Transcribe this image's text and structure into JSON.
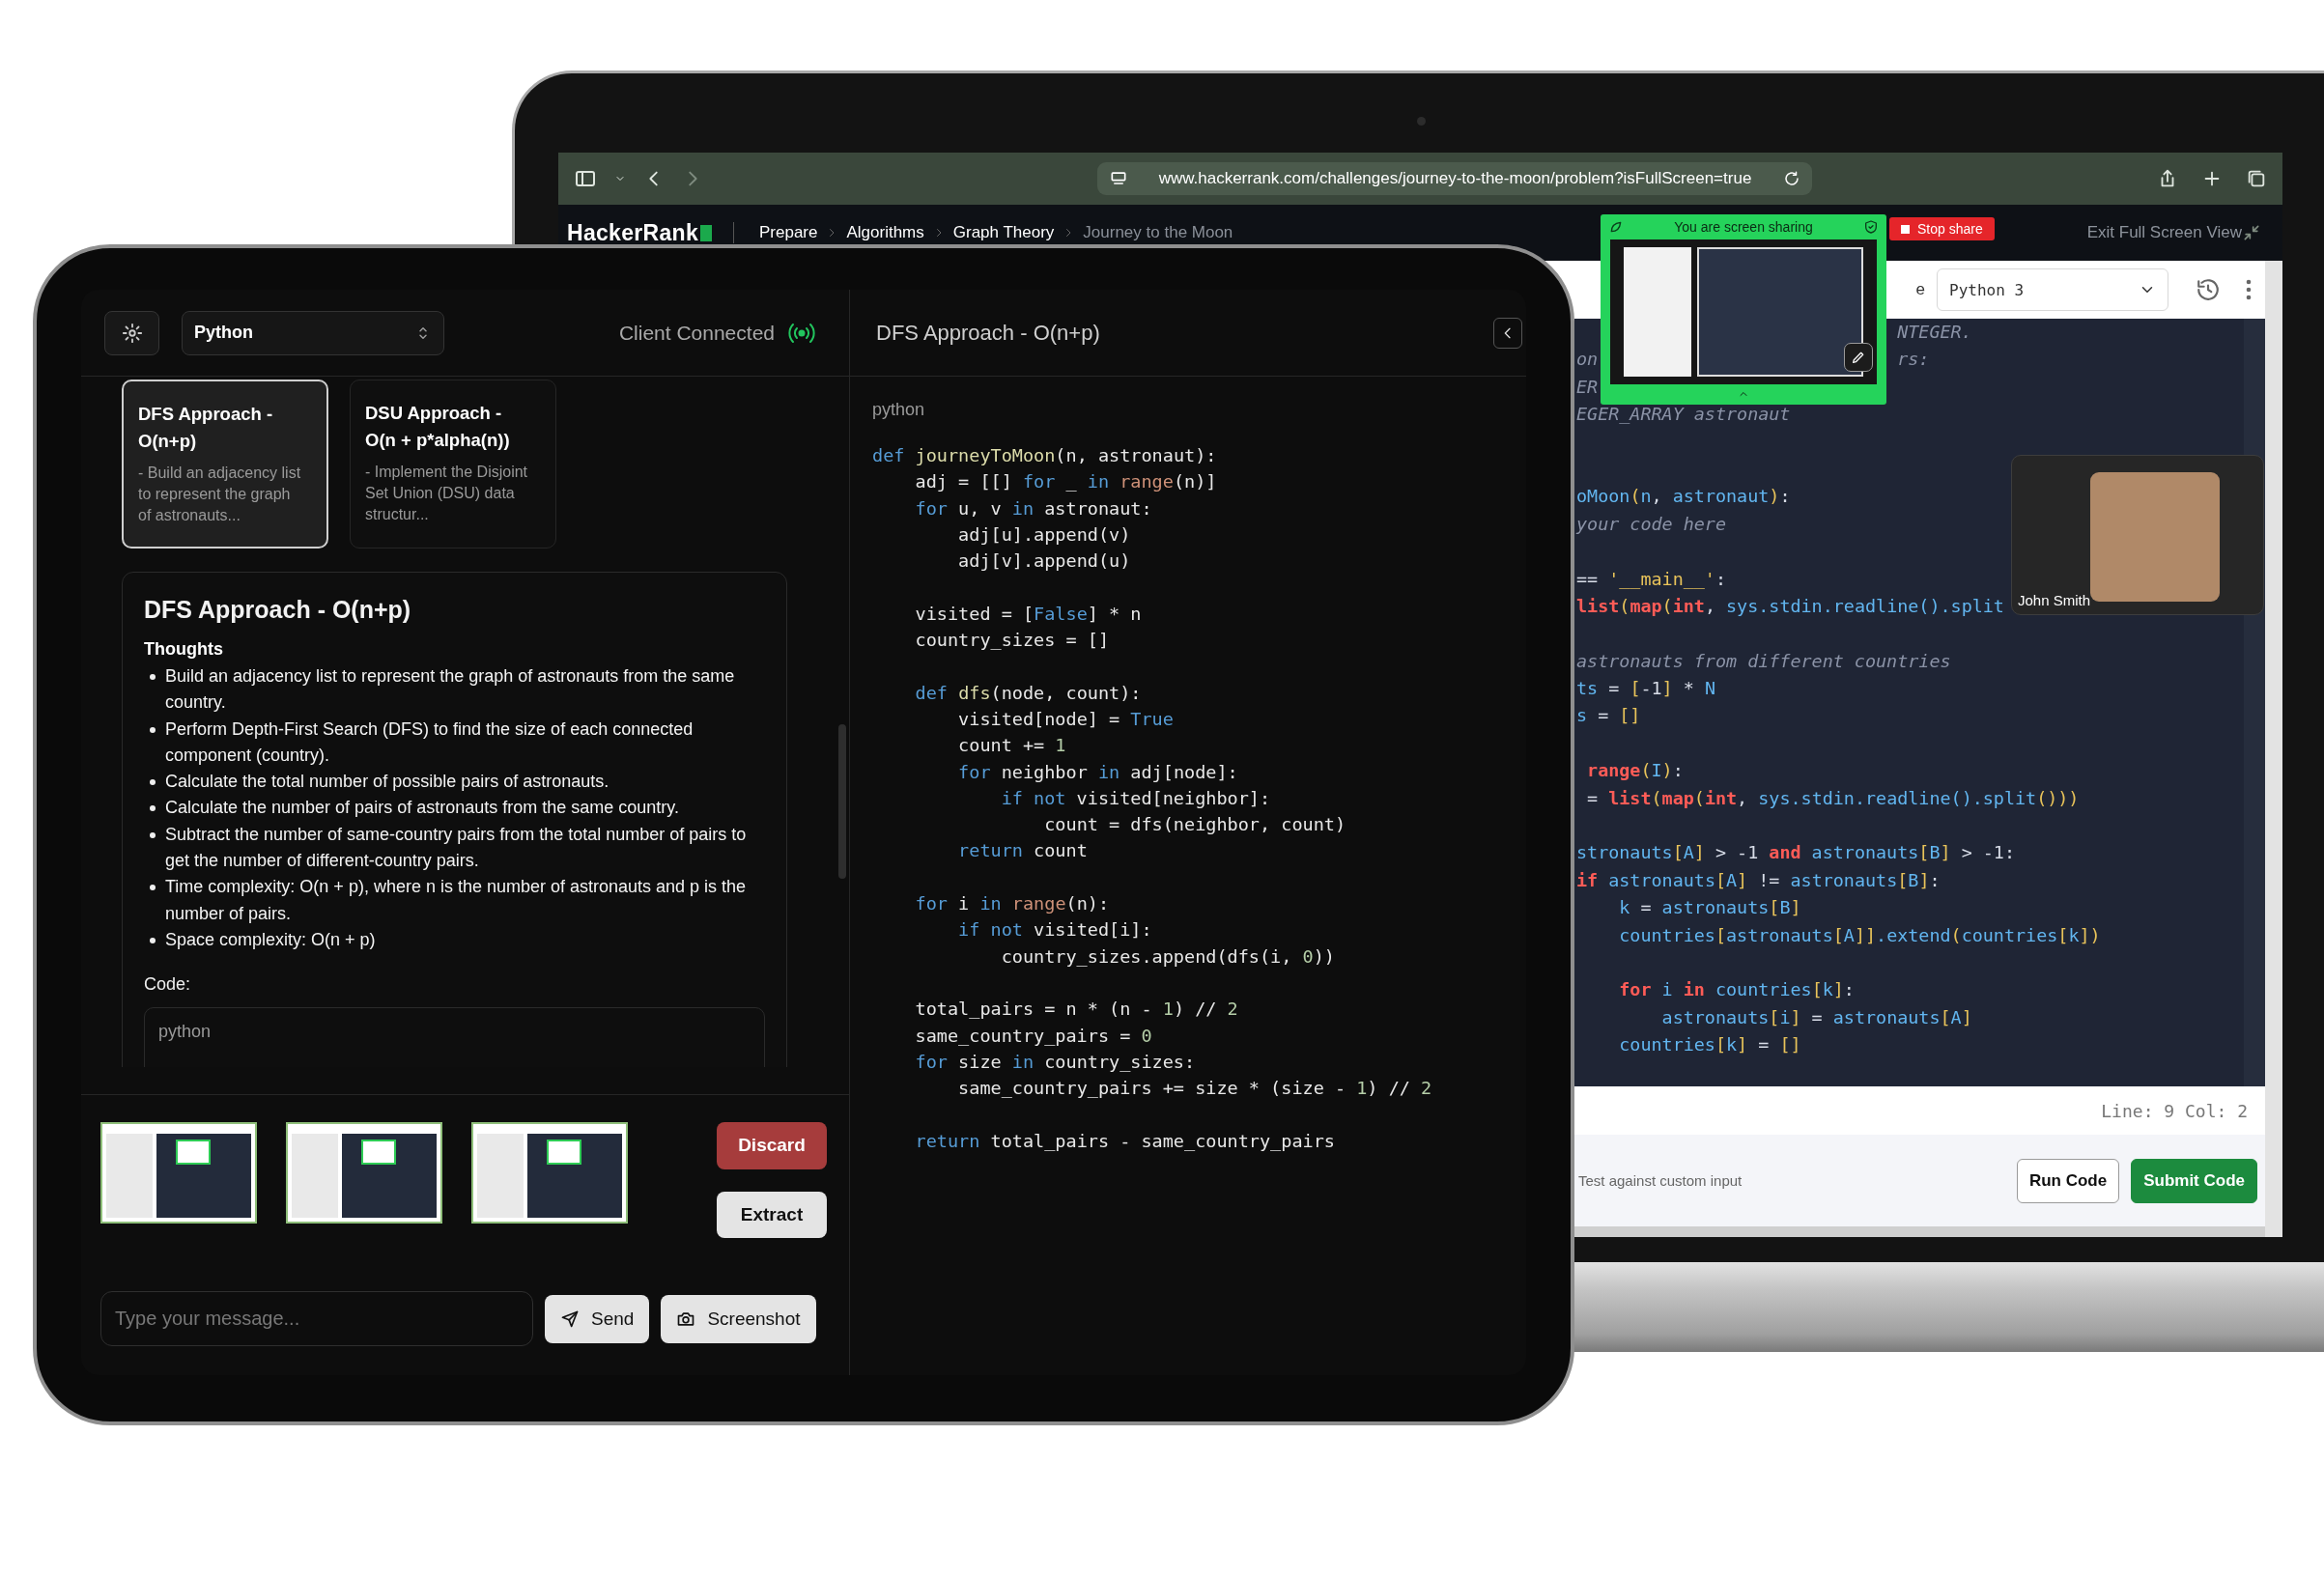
{
  "laptop": {
    "browser": {
      "url": "www.hackerrank.com/challenges/journey-to-the-moon/problem?isFullScreen=true"
    },
    "site_nav": {
      "logo": "HackerRank",
      "breadcrumbs": [
        {
          "label": "Prepare",
          "selected": false
        },
        {
          "label": "Algorithms",
          "selected": false
        },
        {
          "label": "Graph Theory",
          "selected": false
        },
        {
          "label": "Journey to the Moon",
          "selected": true
        }
      ],
      "exit_label": "Exit Full Screen View"
    },
    "screen_share": {
      "message": "You are screen sharing",
      "stop_label": "Stop share"
    },
    "editor": {
      "language_label": "e",
      "language": "Python 3",
      "code": [
        {
          "text": "                              NTEGER.\n",
          "kind": "comment"
        },
        {
          "text": "on                            rs:\n",
          "kind": "comment"
        },
        {
          "text": "ER\n",
          "kind": "comment"
        },
        {
          "text": "EGER_ARRAY astronaut\n\n\n",
          "kind": "comment"
        },
        {
          "text": "oMoon",
          "kind": "identifier"
        },
        {
          "text": "(",
          "kind": "bracket"
        },
        {
          "text": "n",
          "kind": "identifier"
        },
        {
          "text": ", ",
          "kind": "plain"
        },
        {
          "text": "astronaut",
          "kind": "identifier"
        },
        {
          "text": ")",
          "kind": "bracket"
        },
        {
          "text": ":\n",
          "kind": "plain"
        },
        {
          "text": "your code here\n\n",
          "kind": "comment"
        },
        {
          "text": "== ",
          "kind": "plain"
        },
        {
          "text": "'__main__'",
          "kind": "string"
        },
        {
          "text": ":\n",
          "kind": "plain"
        },
        {
          "text": "list",
          "kind": "keyword"
        },
        {
          "text": "(",
          "kind": "bracket"
        },
        {
          "text": "map",
          "kind": "keyword"
        },
        {
          "text": "(",
          "kind": "bracket"
        },
        {
          "text": "int",
          "kind": "keyword"
        },
        {
          "text": ", ",
          "kind": "plain"
        },
        {
          "text": "sys.stdin.readline().split\n\n",
          "kind": "identifier"
        },
        {
          "text": "astronauts from different countries\n",
          "kind": "comment"
        },
        {
          "text": "ts",
          "kind": "identifier"
        },
        {
          "text": " = ",
          "kind": "plain"
        },
        {
          "text": "[",
          "kind": "bracket"
        },
        {
          "text": "-1",
          "kind": "plain"
        },
        {
          "text": "]",
          "kind": "bracket"
        },
        {
          "text": " * ",
          "kind": "plain"
        },
        {
          "text": "N\n",
          "kind": "identifier"
        },
        {
          "text": "s",
          "kind": "identifier"
        },
        {
          "text": " = ",
          "kind": "plain"
        },
        {
          "text": "[]\n\n",
          "kind": "bracket"
        },
        {
          "text": " range",
          "kind": "keyword"
        },
        {
          "text": "(",
          "kind": "bracket"
        },
        {
          "text": "I",
          "kind": "identifier"
        },
        {
          "text": ")",
          "kind": "bracket"
        },
        {
          "text": ":\n = ",
          "kind": "plain"
        },
        {
          "text": "list",
          "kind": "keyword"
        },
        {
          "text": "(",
          "kind": "bracket"
        },
        {
          "text": "map",
          "kind": "keyword"
        },
        {
          "text": "(",
          "kind": "bracket"
        },
        {
          "text": "int",
          "kind": "keyword"
        },
        {
          "text": ", ",
          "kind": "plain"
        },
        {
          "text": "sys.stdin.readline().split",
          "kind": "identifier"
        },
        {
          "text": "()))\n\n",
          "kind": "bracket"
        },
        {
          "text": "stronauts",
          "kind": "identifier"
        },
        {
          "text": "[",
          "kind": "bracket"
        },
        {
          "text": "A",
          "kind": "identifier"
        },
        {
          "text": "]",
          "kind": "bracket"
        },
        {
          "text": " > -1 ",
          "kind": "plain"
        },
        {
          "text": "and",
          "kind": "keyword"
        },
        {
          "text": " astronauts",
          "kind": "identifier"
        },
        {
          "text": "[",
          "kind": "bracket"
        },
        {
          "text": "B",
          "kind": "identifier"
        },
        {
          "text": "]",
          "kind": "bracket"
        },
        {
          "text": " > -1:\n",
          "kind": "plain"
        },
        {
          "text": "if",
          "kind": "keyword"
        },
        {
          "text": " astronauts",
          "kind": "identifier"
        },
        {
          "text": "[",
          "kind": "bracket"
        },
        {
          "text": "A",
          "kind": "identifier"
        },
        {
          "text": "]",
          "kind": "bracket"
        },
        {
          "text": " != ",
          "kind": "plain"
        },
        {
          "text": "astronauts",
          "kind": "identifier"
        },
        {
          "text": "[",
          "kind": "bracket"
        },
        {
          "text": "B",
          "kind": "identifier"
        },
        {
          "text": "]",
          "kind": "bracket"
        },
        {
          "text": ":\n",
          "kind": "plain"
        },
        {
          "text": "    k",
          "kind": "identifier"
        },
        {
          "text": " = ",
          "kind": "plain"
        },
        {
          "text": "astronauts",
          "kind": "identifier"
        },
        {
          "text": "[",
          "kind": "bracket"
        },
        {
          "text": "B",
          "kind": "identifier"
        },
        {
          "text": "]\n",
          "kind": "bracket"
        },
        {
          "text": "    countries",
          "kind": "identifier"
        },
        {
          "text": "[",
          "kind": "bracket"
        },
        {
          "text": "astronauts",
          "kind": "identifier"
        },
        {
          "text": "[",
          "kind": "bracket"
        },
        {
          "text": "A",
          "kind": "identifier"
        },
        {
          "text": "]]",
          "kind": "bracket"
        },
        {
          "text": ".extend",
          "kind": "identifier"
        },
        {
          "text": "(",
          "kind": "bracket"
        },
        {
          "text": "countries",
          "kind": "identifier"
        },
        {
          "text": "[",
          "kind": "bracket"
        },
        {
          "text": "k",
          "kind": "identifier"
        },
        {
          "text": "])\n\n",
          "kind": "bracket"
        },
        {
          "text": "    for",
          "kind": "keyword"
        },
        {
          "text": " i ",
          "kind": "identifier"
        },
        {
          "text": "in",
          "kind": "keyword"
        },
        {
          "text": " countries",
          "kind": "identifier"
        },
        {
          "text": "[",
          "kind": "bracket"
        },
        {
          "text": "k",
          "kind": "identifier"
        },
        {
          "text": "]",
          "kind": "bracket"
        },
        {
          "text": ":\n",
          "kind": "plain"
        },
        {
          "text": "        astronauts",
          "kind": "identifier"
        },
        {
          "text": "[",
          "kind": "bracket"
        },
        {
          "text": "i",
          "kind": "identifier"
        },
        {
          "text": "]",
          "kind": "bracket"
        },
        {
          "text": " = ",
          "kind": "plain"
        },
        {
          "text": "astronauts",
          "kind": "identifier"
        },
        {
          "text": "[",
          "kind": "bracket"
        },
        {
          "text": "A",
          "kind": "identifier"
        },
        {
          "text": "]\n",
          "kind": "bracket"
        },
        {
          "text": "    countries",
          "kind": "identifier"
        },
        {
          "text": "[",
          "kind": "bracket"
        },
        {
          "text": "k",
          "kind": "identifier"
        },
        {
          "text": "]",
          "kind": "bracket"
        },
        {
          "text": " = ",
          "kind": "plain"
        },
        {
          "text": "[]",
          "kind": "bracket"
        }
      ],
      "status": "Line: 9 Col: 2",
      "custom_input_label": "Test against custom input",
      "buttons": [
        {
          "label": "Run Code",
          "kind": "secondary"
        },
        {
          "label": "Submit Code",
          "kind": "primary"
        }
      ]
    },
    "video_tile": {
      "name": "John Smith"
    }
  },
  "tablet": {
    "header": {
      "language": "Python",
      "status": "Client Connected",
      "connected": true
    },
    "approaches": [
      {
        "title": "DFS Approach - O(n+p)",
        "summary": "- Build an adjacency list to represent the graph of astronauts...",
        "selected": true
      },
      {
        "title": "DSU Approach - O(n + p*alpha(n))",
        "summary": "- Implement the Disjoint Set Union (DSU) data structur...",
        "selected": false
      }
    ],
    "detail": {
      "title": "DFS Approach - O(n+p)",
      "thoughts_label": "Thoughts",
      "thoughts": [
        "Build an adjacency list to represent the graph of astronauts from the same country.",
        "Perform Depth-First Search (DFS) to find the size of each connected component (country).",
        "Calculate the total number of possible pairs of astronauts.",
        "Calculate the number of pairs of astronauts from the same country.",
        "Subtract the number of same-country pairs from the total number of pairs to get the number of different-country pairs.",
        "Time complexity: O(n + p), where n is the number of astronauts and p is the number of pairs.",
        "Space complexity: O(n + p)"
      ],
      "code_label": "Code:",
      "code_language": "python"
    },
    "actions": [
      {
        "label": "Discard",
        "kind": "danger"
      },
      {
        "label": "Extract",
        "kind": "neutral"
      }
    ],
    "composer": {
      "placeholder": "Type your message...",
      "buttons": [
        {
          "label": "Send",
          "kind": "send"
        },
        {
          "label": "Screenshot",
          "kind": "screenshot"
        }
      ]
    },
    "solution": {
      "title": "DFS Approach - O(n+p)",
      "language": "python",
      "code": [
        {
          "text": "def ",
          "kind": "keyword"
        },
        {
          "text": "journeyToMoon",
          "kind": "function"
        },
        {
          "text": "(n, astronaut):\n    adj = [[] ",
          "kind": "plain"
        },
        {
          "text": "for",
          "kind": "keyword"
        },
        {
          "text": " _ ",
          "kind": "plain"
        },
        {
          "text": "in ",
          "kind": "keyword"
        },
        {
          "text": "range",
          "kind": "builtin"
        },
        {
          "text": "(n)]\n    ",
          "kind": "plain"
        },
        {
          "text": "for",
          "kind": "keyword"
        },
        {
          "text": " u, v ",
          "kind": "plain"
        },
        {
          "text": "in",
          "kind": "keyword"
        },
        {
          "text": " astronaut:\n        adj[u].append(v)\n        adj[v].append(u)\n\n    visited = [",
          "kind": "plain"
        },
        {
          "text": "False",
          "kind": "keyword"
        },
        {
          "text": "] * n\n    country_sizes = []\n\n    ",
          "kind": "plain"
        },
        {
          "text": "def ",
          "kind": "keyword"
        },
        {
          "text": "dfs",
          "kind": "function"
        },
        {
          "text": "(node, count):\n        visited[node] = ",
          "kind": "plain"
        },
        {
          "text": "True",
          "kind": "keyword"
        },
        {
          "text": "\n        count += ",
          "kind": "plain"
        },
        {
          "text": "1",
          "kind": "number"
        },
        {
          "text": "\n        for",
          "kind": "keyword"
        },
        {
          "text": " neighbor ",
          "kind": "plain"
        },
        {
          "text": "in",
          "kind": "keyword"
        },
        {
          "text": " adj[node]:\n            ",
          "kind": "plain"
        },
        {
          "text": "if not",
          "kind": "keyword"
        },
        {
          "text": " visited[neighbor]:\n                count = dfs(neighbor, count)\n        ",
          "kind": "plain"
        },
        {
          "text": "return",
          "kind": "keyword"
        },
        {
          "text": " count\n\n    ",
          "kind": "plain"
        },
        {
          "text": "for",
          "kind": "keyword"
        },
        {
          "text": " i ",
          "kind": "plain"
        },
        {
          "text": "in ",
          "kind": "keyword"
        },
        {
          "text": "range",
          "kind": "builtin"
        },
        {
          "text": "(n):\n        ",
          "kind": "plain"
        },
        {
          "text": "if not",
          "kind": "keyword"
        },
        {
          "text": " visited[i]:\n            country_sizes.append(dfs(i, ",
          "kind": "plain"
        },
        {
          "text": "0",
          "kind": "number"
        },
        {
          "text": "))\n\n    total_pairs = n * (n - ",
          "kind": "plain"
        },
        {
          "text": "1",
          "kind": "number"
        },
        {
          "text": ") // ",
          "kind": "plain"
        },
        {
          "text": "2",
          "kind": "number"
        },
        {
          "text": "\n    same_country_pairs = ",
          "kind": "plain"
        },
        {
          "text": "0\n",
          "kind": "number"
        },
        {
          "text": "    for",
          "kind": "keyword"
        },
        {
          "text": " size ",
          "kind": "plain"
        },
        {
          "text": "in",
          "kind": "keyword"
        },
        {
          "text": " country_sizes:\n        same_country_pairs += size * (size - ",
          "kind": "plain"
        },
        {
          "text": "1",
          "kind": "number"
        },
        {
          "text": ") // ",
          "kind": "plain"
        },
        {
          "text": "2\n\n",
          "kind": "number"
        },
        {
          "text": "    return",
          "kind": "keyword"
        },
        {
          "text": " total_pairs - same_country_pairs",
          "kind": "plain"
        }
      ]
    }
  }
}
